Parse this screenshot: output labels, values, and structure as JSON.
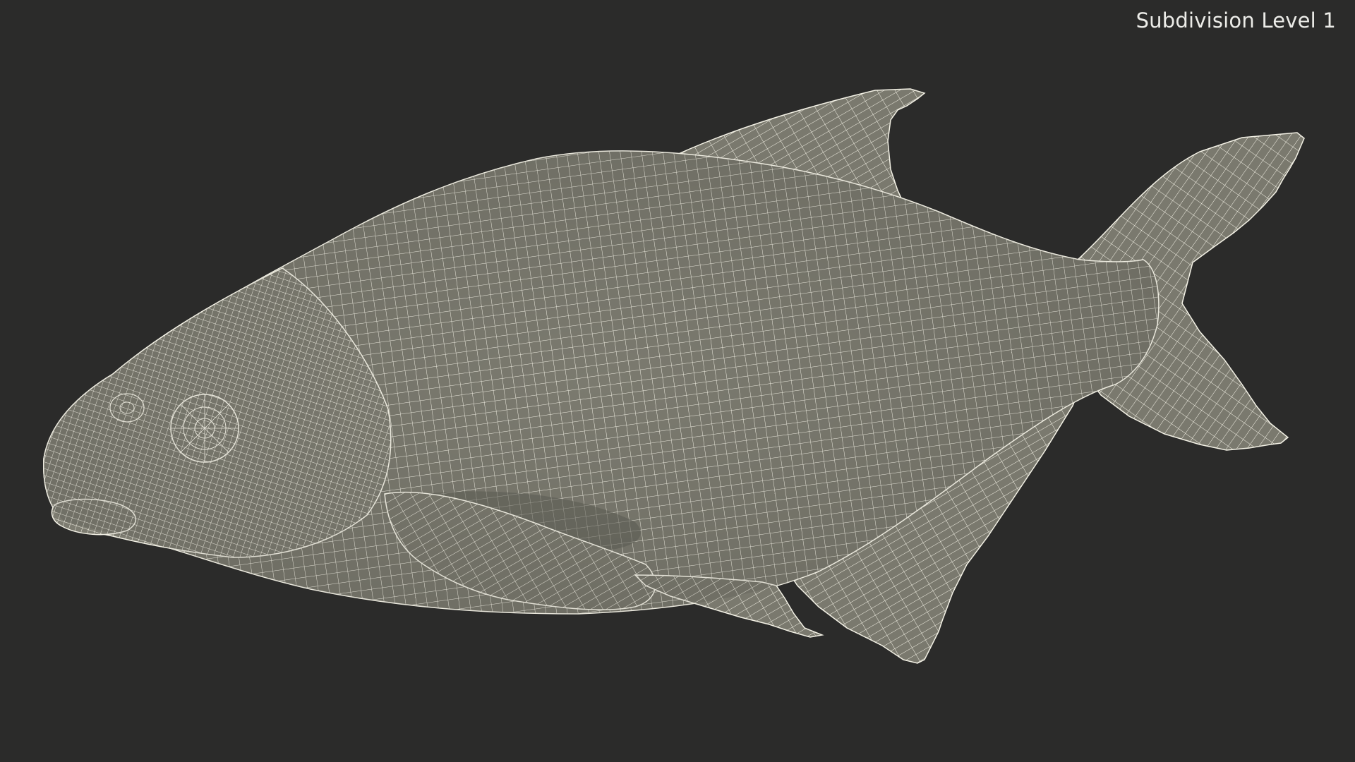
{
  "viewport": {
    "label": "Subdivision Level 1",
    "background_color": "#2b2b2a",
    "surface_color": "#7b7a6f",
    "wire_color": "#f4f2e6"
  },
  "model": {
    "subject": "fish-wireframe",
    "parts": [
      "body",
      "head",
      "eye",
      "mouth",
      "dorsal-fin",
      "tail-fin",
      "pectoral-fin",
      "pelvic-fin",
      "anal-fin"
    ]
  }
}
